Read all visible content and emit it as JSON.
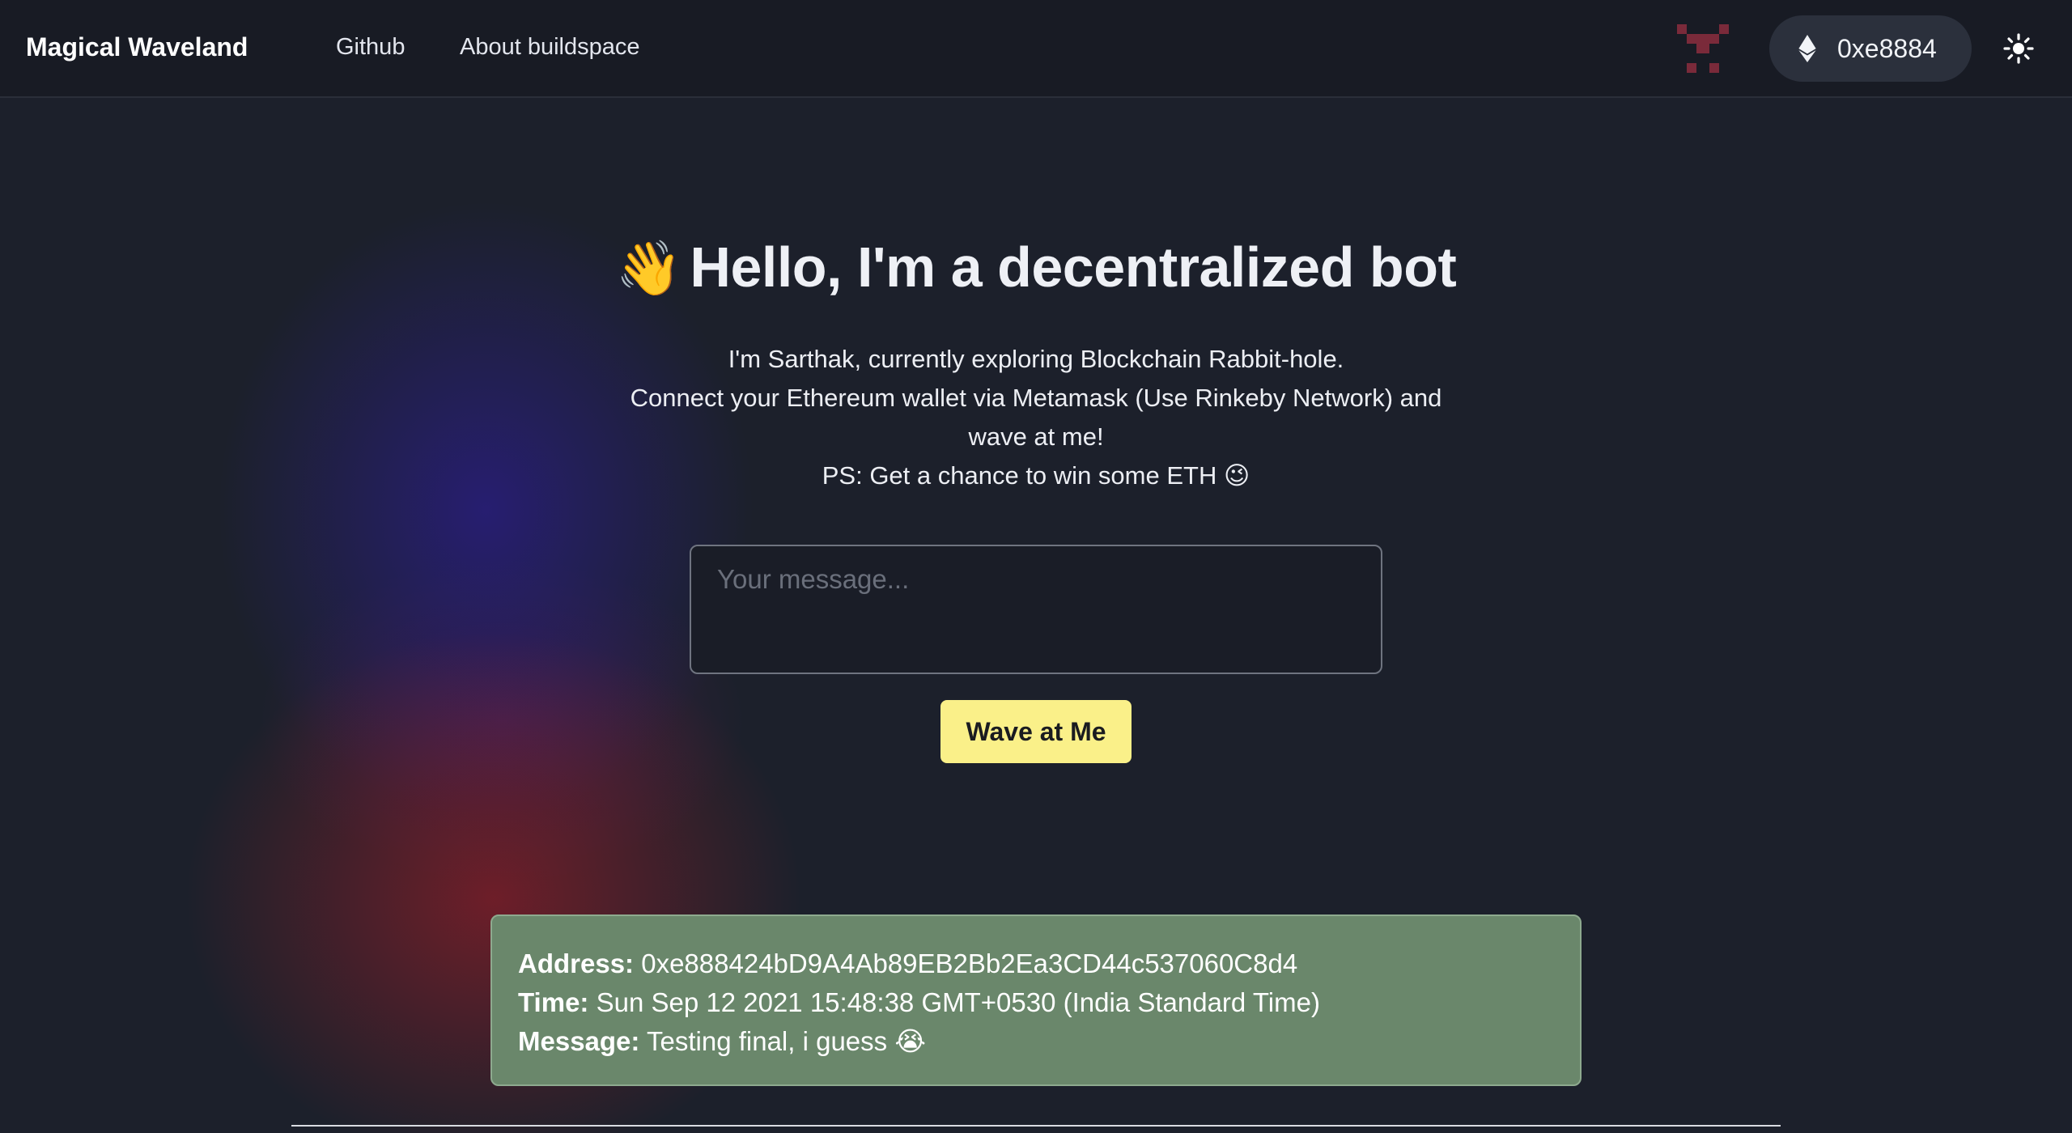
{
  "header": {
    "brand": "Magical Waveland",
    "nav": [
      {
        "label": "Github"
      },
      {
        "label": "About buildspace"
      }
    ],
    "wallet_address": "0xe8884",
    "icons": {
      "avatar": "identicon-avatar",
      "wallet": "ethereum-icon",
      "theme": "sun-icon"
    }
  },
  "hero": {
    "emoji": "👋",
    "title": "Hello, I'm a decentralized bot",
    "intro_line1": "I'm Sarthak, currently exploring Blockchain Rabbit-hole.",
    "intro_line2": "Connect your Ethereum wallet via Metamask (Use Rinkeby Network) and wave at me!",
    "intro_line3": "PS: Get a chance to win some ETH 😉"
  },
  "form": {
    "message_placeholder": "Your message...",
    "message_value": "",
    "submit_label": "Wave at Me"
  },
  "waves": [
    {
      "address_label": "Address:",
      "address": "0xe888424bD9A4Ab89EB2Bb2Ea3CD44c537060C8d4",
      "time_label": "Time:",
      "time": "Sun Sep 12 2021 15:48:38 GMT+0530 (India Standard Time)",
      "message_label": "Message:",
      "message": "Testing final, i guess 😭"
    }
  ],
  "colors": {
    "background": "#1c202b",
    "header": "#181b24",
    "button_accent": "#faf089",
    "wave_card": "#6a876b",
    "avatar": "#7a2a3a"
  }
}
